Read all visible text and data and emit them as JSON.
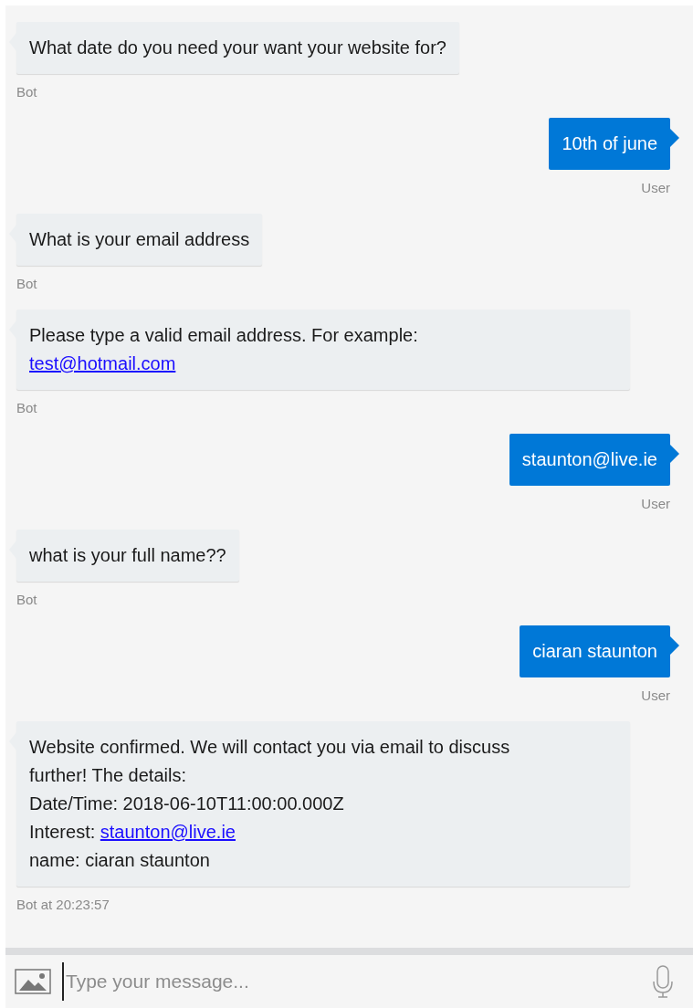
{
  "messages": [
    {
      "kind": "bot",
      "lines": [
        {
          "text": "What date do you need your want your website for?"
        }
      ],
      "meta": "Bot"
    },
    {
      "kind": "user",
      "lines": [
        {
          "text": "10th of june"
        }
      ],
      "meta": "User"
    },
    {
      "kind": "bot",
      "lines": [
        {
          "text": "What is your email address"
        }
      ],
      "meta": "Bot"
    },
    {
      "kind": "bot",
      "lines": [
        {
          "text": "Please type a valid email address. For example:"
        },
        {
          "link": "test@hotmail.com"
        }
      ],
      "meta": "Bot"
    },
    {
      "kind": "user",
      "lines": [
        {
          "text": "staunton@live.ie"
        }
      ],
      "meta": "User"
    },
    {
      "kind": "bot",
      "lines": [
        {
          "text": "what is your full name??"
        }
      ],
      "meta": "Bot"
    },
    {
      "kind": "user",
      "lines": [
        {
          "text": "ciaran staunton"
        }
      ],
      "meta": "User"
    },
    {
      "kind": "bot",
      "lines": [
        {
          "text": "Website confirmed. We will contact you via email to discuss"
        },
        {
          "text": "further! The details:"
        },
        {
          "text": "Date/Time: 2018-06-10T11:00:00.000Z"
        },
        {
          "text": "Interest: ",
          "link": "staunton@live.ie"
        },
        {
          "text": "name: ciaran staunton"
        }
      ],
      "meta": "Bot at 20:23:57"
    }
  ],
  "composer": {
    "placeholder": "Type your message..."
  }
}
